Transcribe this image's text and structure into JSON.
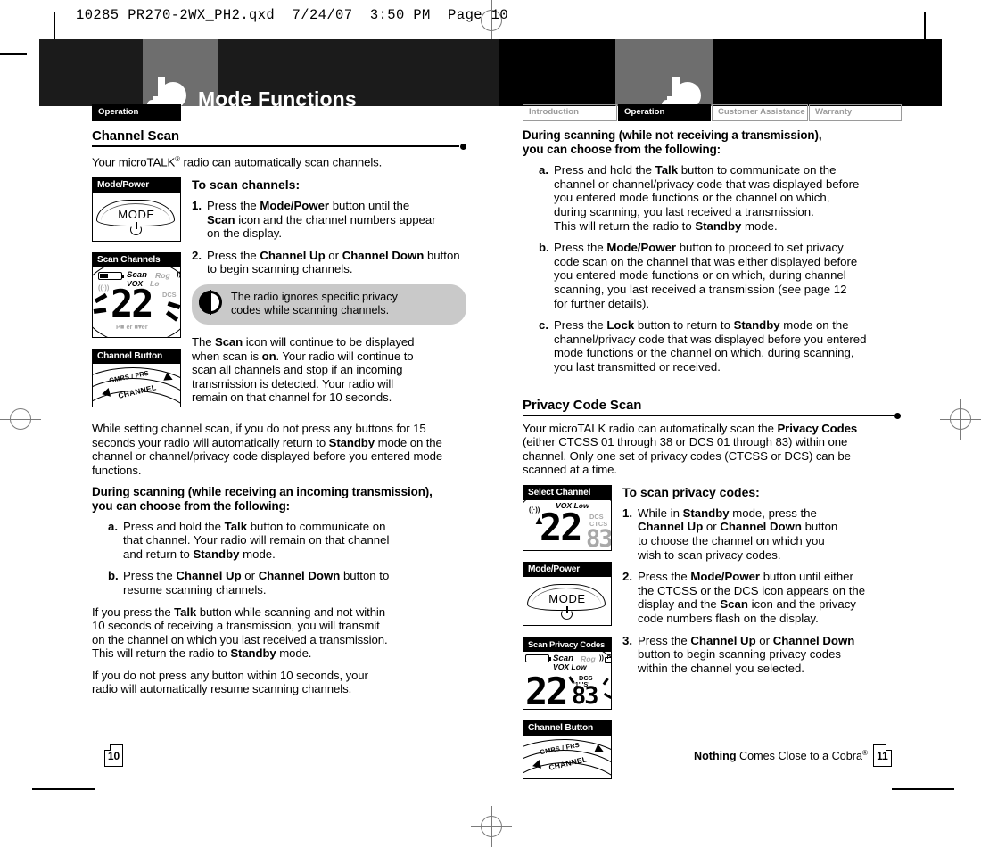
{
  "file_header": "10285 PR270-2WX_PH2.qxd  7/24/07  3:50 PM  Page 10",
  "banner": {
    "title": "Mode Functions",
    "logo_icon": "cobra-snake-logo"
  },
  "tabs_left": [
    {
      "label": "Operation",
      "active": true
    }
  ],
  "tabs_right": [
    {
      "label": "Introduction",
      "active": false
    },
    {
      "label": "Operation",
      "active": true
    },
    {
      "label": "Customer Assistance",
      "active": false
    },
    {
      "label": "Warranty",
      "active": false
    }
  ],
  "left_page": {
    "section_title": "Channel Scan",
    "intro": "Your microTALK® radio can automatically scan channels.",
    "intro_pre": "Your microTALK",
    "intro_sup": "®",
    "intro_post": " radio can automatically scan channels.",
    "to_scan_heading": "To scan channels:",
    "steps": [
      {
        "marker": "1.",
        "text": "Press the Mode/Power button until the Scan icon and the channel numbers appear on the display."
      },
      {
        "marker": "2.",
        "text": "Press the Channel Up or Channel Down button to begin scanning channels."
      }
    ],
    "tip": "The radio ignores specific privacy codes while scanning channels.",
    "scan_icon_para": "The Scan icon will continue to be displayed when scan is on. Your radio will continue to scan all channels and stop if an incoming transmission is detected. Your radio will remain on that channel for 10 seconds.",
    "timeout_para": "While setting channel scan, if you do not press any buttons for 15 seconds your radio will automatically return to Standby mode on the channel or channel/privacy code displayed before you entered mode functions.",
    "during_heading_l1": "During scanning (while receiving an incoming transmission),",
    "during_heading_l2": "you can choose from the following:",
    "during_items": [
      {
        "marker": "a.",
        "text": "Press and hold the Talk button to communicate on that channel. Your radio will remain on that channel and return to Standby mode."
      },
      {
        "marker": "b.",
        "text": "Press the Channel Up or Channel Down button to resume scanning channels."
      }
    ],
    "talk_para": "If you press the Talk button while scanning and not within 10 seconds of receiving a transmission, you will transmit on the channel on which you last received a transmission. This will return the radio to Standby mode.",
    "nopress_para": "If you do not press any button within 10 seconds, your radio will automatically resume scanning channels.",
    "figures": [
      {
        "caption": "Mode/Power",
        "art": "mode-power-button",
        "button_label": "MODE"
      },
      {
        "caption": "Scan Channels",
        "art": "lcd-display",
        "digits": "22",
        "labels": [
          "Scan",
          "Rog",
          "VOX",
          "Lo",
          "DCS",
          "Power",
          "Saver"
        ]
      },
      {
        "caption": "Channel Button",
        "art": "channel-rocker",
        "labels": [
          "GMRS / FRS",
          "CHANNEL"
        ]
      }
    ]
  },
  "right_page": {
    "during_heading_l1": "During scanning (while not receiving a transmission),",
    "during_heading_l2": "you can choose from the following:",
    "during_items": [
      {
        "marker": "a.",
        "text": "Press and hold the Talk button to communicate on the channel or channel/privacy code that was displayed before you entered mode functions or the channel on which, during scanning, you last received a transmission. This will return the radio to Standby mode."
      },
      {
        "marker": "b.",
        "text": "Press the Mode/Power button to proceed to set privacy code scan on the channel that was either displayed before you entered mode functions or on which, during channel scanning, you last received a transmission (see page 12 for further details)."
      },
      {
        "marker": "c.",
        "text": "Press the Lock button to return to Standby mode on the channel/privacy code that was displayed before you entered mode functions or the channel on which, during scanning, you last transmitted or received."
      }
    ],
    "section_title": "Privacy Code Scan",
    "intro": "Your microTALK radio can automatically scan the Privacy Codes (either CTCSS 01 through 38 or DCS 01 through 83) within one channel. Only one set of privacy codes (CTCSS or DCS) can be scanned at a time.",
    "to_scan_heading": "To scan privacy codes:",
    "steps": [
      {
        "marker": "1.",
        "text": "While in Standby mode, press the Channel Up or Channel Down button to choose the channel on which you wish to scan privacy codes."
      },
      {
        "marker": "2.",
        "text": "Press the Mode/Power button until either the CTCSS or the DCS icon appears on the display and the Scan icon and the privacy code numbers flash on the display."
      },
      {
        "marker": "3.",
        "text": "Press the Channel Up or Channel Down button to begin scanning privacy codes within the channel you selected."
      }
    ],
    "figures": [
      {
        "caption": "Select Channel",
        "art": "lcd-display",
        "digits": "22",
        "sub_digits": "83",
        "labels": [
          "VOX",
          "Low",
          "DCS",
          "CTCSS"
        ]
      },
      {
        "caption": "Mode/Power",
        "art": "mode-power-button",
        "button_label": "MODE"
      },
      {
        "caption": "Scan Privacy Codes",
        "art": "lcd-display",
        "digits": "22",
        "sub_digits": "83",
        "labels": [
          "Scan",
          "Rog",
          "VOX",
          "Low",
          "DCS"
        ]
      },
      {
        "caption": "Channel Button",
        "art": "channel-rocker",
        "labels": [
          "GMRS / FRS",
          "CHANNEL"
        ]
      }
    ]
  },
  "footer": {
    "left_page_number": "10",
    "right_page_number": "11",
    "tagline_bold": "Nothing",
    "tagline_rest": " Comes Close to a Cobra",
    "tagline_sup": "®"
  }
}
